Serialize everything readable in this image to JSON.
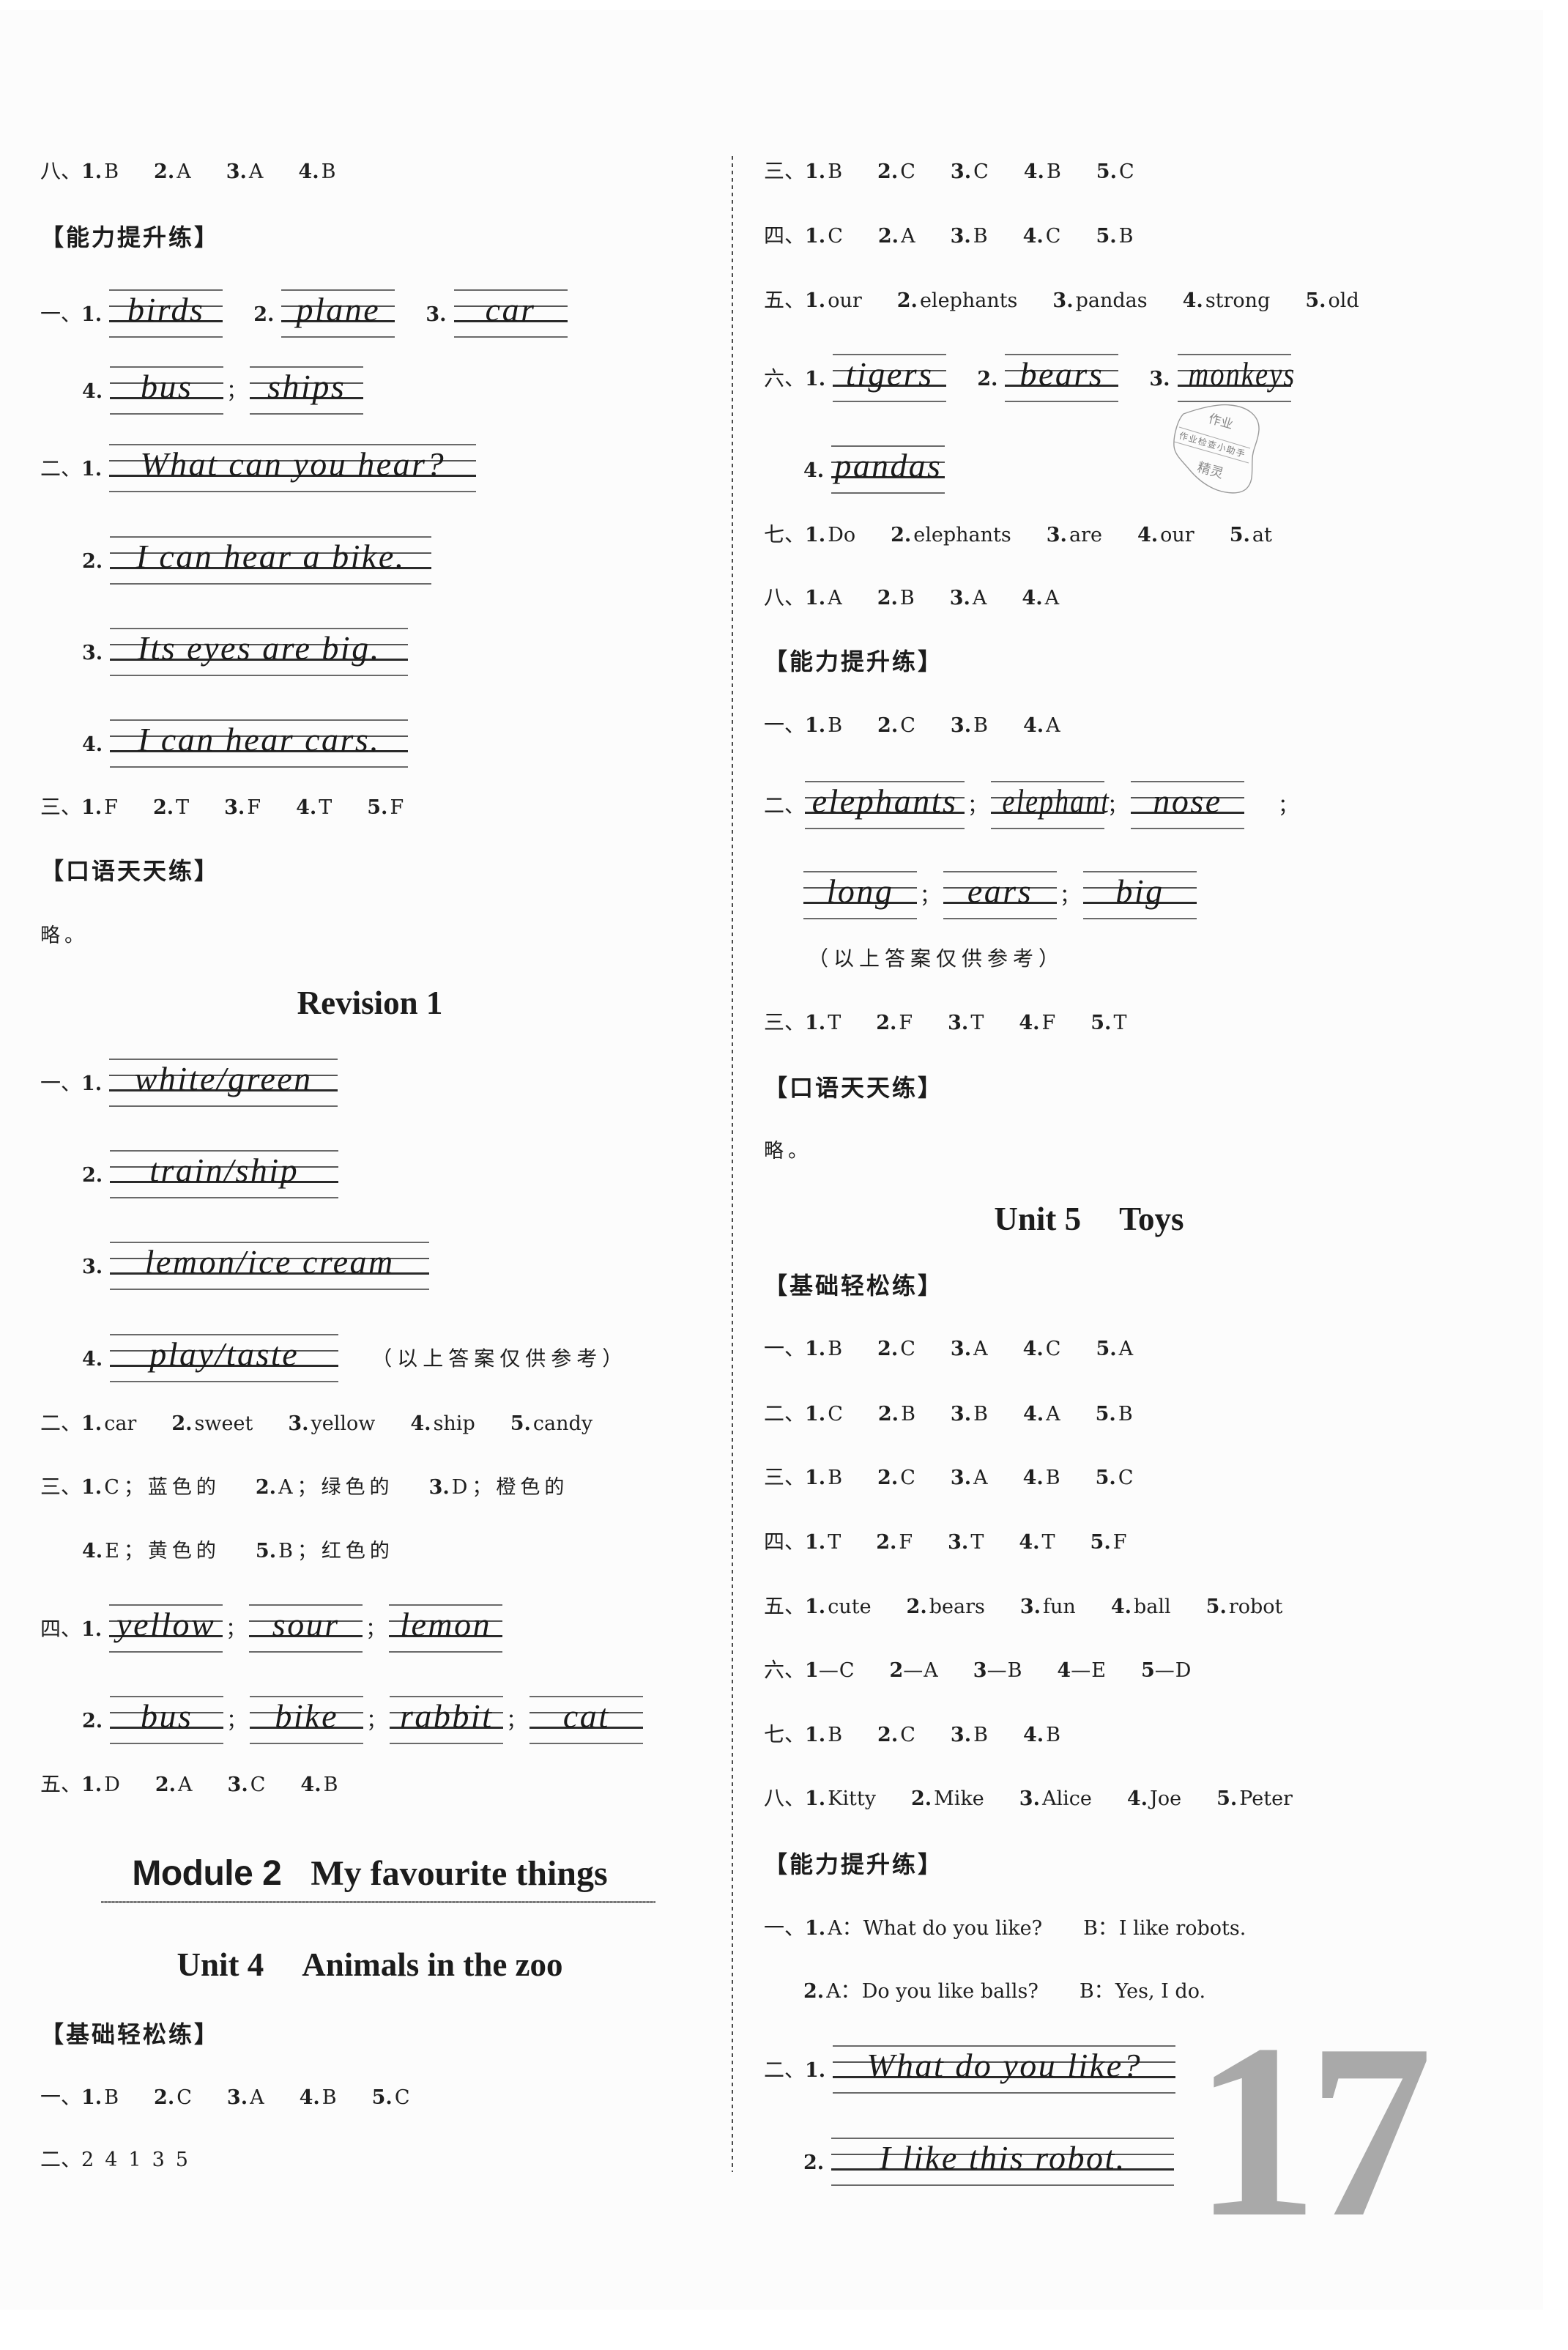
{
  "page_number": "17",
  "blank_separator": "；",
  "stamp": {
    "top": "作业",
    "band": "作业检查小助手",
    "bottom": "精灵"
  },
  "left_column": [
    {
      "kind": "answers",
      "section": "八、",
      "items": [
        {
          "n": "1.",
          "a": "B"
        },
        {
          "n": "2.",
          "a": "A"
        },
        {
          "n": "3.",
          "a": "A"
        },
        {
          "n": "4.",
          "a": "B"
        }
      ]
    },
    {
      "kind": "heading",
      "text": "【能力提升练】"
    },
    {
      "kind": "writing",
      "section": "一、",
      "items": [
        {
          "n": "1.",
          "blanks": [
            "birds"
          ]
        },
        {
          "n": "2.",
          "blanks": [
            "plane"
          ]
        },
        {
          "n": "3.",
          "blanks": [
            "car"
          ]
        }
      ]
    },
    {
      "kind": "writing",
      "items": [
        {
          "n": "4.",
          "blanks": [
            "bus",
            "ships"
          ]
        }
      ]
    },
    {
      "kind": "writing",
      "section": "二、",
      "items": [
        {
          "n": "1.",
          "blanks": [
            "What can you hear?"
          ]
        }
      ]
    },
    {
      "kind": "writing",
      "items": [
        {
          "n": "2.",
          "blanks": [
            "I can hear a bike."
          ]
        }
      ]
    },
    {
      "kind": "writing",
      "items": [
        {
          "n": "3.",
          "blanks": [
            "Its eyes are big."
          ]
        }
      ]
    },
    {
      "kind": "writing",
      "items": [
        {
          "n": "4.",
          "blanks": [
            "I can hear cars."
          ]
        }
      ]
    },
    {
      "kind": "answers",
      "section": "三、",
      "items": [
        {
          "n": "1.",
          "a": "F"
        },
        {
          "n": "2.",
          "a": "T"
        },
        {
          "n": "3.",
          "a": "F"
        },
        {
          "n": "4.",
          "a": "T"
        },
        {
          "n": "5.",
          "a": "F"
        }
      ]
    },
    {
      "kind": "heading",
      "text": "【口语天天练】"
    },
    {
      "kind": "text",
      "text": "略。"
    },
    {
      "kind": "title",
      "text": "Revision 1"
    },
    {
      "kind": "writing",
      "section": "一、",
      "items": [
        {
          "n": "1.",
          "blanks": [
            "white/green"
          ]
        }
      ]
    },
    {
      "kind": "writing",
      "items": [
        {
          "n": "2.",
          "blanks": [
            "train/ship"
          ]
        }
      ]
    },
    {
      "kind": "writing",
      "items": [
        {
          "n": "3.",
          "blanks": [
            "lemon/ice cream"
          ]
        }
      ]
    },
    {
      "kind": "writing",
      "items": [
        {
          "n": "4.",
          "blanks": [
            "play/taste"
          ]
        }
      ],
      "note": "（以上答案仅供参考）"
    },
    {
      "kind": "answers",
      "section": "二、",
      "items": [
        {
          "n": "1.",
          "a": "car"
        },
        {
          "n": "2.",
          "a": "sweet"
        },
        {
          "n": "3.",
          "a": "yellow"
        },
        {
          "n": "4.",
          "a": "ship"
        },
        {
          "n": "5.",
          "a": "candy"
        }
      ]
    },
    {
      "kind": "answers",
      "section": "三、",
      "items": [
        {
          "n": "1.",
          "a": "C；蓝色的"
        },
        {
          "n": "2.",
          "a": "A；绿色的"
        },
        {
          "n": "3.",
          "a": "D；橙色的"
        }
      ]
    },
    {
      "kind": "answers",
      "items": [
        {
          "n": "4.",
          "a": "E；黄色的"
        },
        {
          "n": "5.",
          "a": "B；红色的"
        }
      ]
    },
    {
      "kind": "writing",
      "section": "四、",
      "items": [
        {
          "n": "1.",
          "blanks": [
            "yellow",
            "sour",
            "lemon"
          ]
        }
      ]
    },
    {
      "kind": "writing",
      "items": [
        {
          "n": "2.",
          "blanks": [
            "bus",
            "bike",
            "rabbit",
            "cat"
          ]
        }
      ]
    },
    {
      "kind": "answers",
      "section": "五、",
      "items": [
        {
          "n": "1.",
          "a": "D"
        },
        {
          "n": "2.",
          "a": "A"
        },
        {
          "n": "3.",
          "a": "C"
        },
        {
          "n": "4.",
          "a": "B"
        }
      ]
    },
    {
      "kind": "module_title",
      "label": "Module 2",
      "text": "My favourite things"
    },
    {
      "kind": "title",
      "label": "Unit 4",
      "text": "Animals in the zoo"
    },
    {
      "kind": "heading",
      "text": "【基础轻松练】"
    },
    {
      "kind": "answers",
      "section": "一、",
      "items": [
        {
          "n": "1.",
          "a": "B"
        },
        {
          "n": "2.",
          "a": "C"
        },
        {
          "n": "3.",
          "a": "A"
        },
        {
          "n": "4.",
          "a": "B"
        },
        {
          "n": "5.",
          "a": "C"
        }
      ]
    },
    {
      "kind": "sequence",
      "section": "二、",
      "values": [
        "2",
        "4",
        "1",
        "3",
        "5"
      ]
    }
  ],
  "right_column": [
    {
      "kind": "answers",
      "section": "三、",
      "items": [
        {
          "n": "1.",
          "a": "B"
        },
        {
          "n": "2.",
          "a": "C"
        },
        {
          "n": "3.",
          "a": "C"
        },
        {
          "n": "4.",
          "a": "B"
        },
        {
          "n": "5.",
          "a": "C"
        }
      ]
    },
    {
      "kind": "answers",
      "section": "四、",
      "items": [
        {
          "n": "1.",
          "a": "C"
        },
        {
          "n": "2.",
          "a": "A"
        },
        {
          "n": "3.",
          "a": "B"
        },
        {
          "n": "4.",
          "a": "C"
        },
        {
          "n": "5.",
          "a": "B"
        }
      ]
    },
    {
      "kind": "answers",
      "section": "五、",
      "items": [
        {
          "n": "1.",
          "a": "our"
        },
        {
          "n": "2.",
          "a": "elephants"
        },
        {
          "n": "3.",
          "a": "pandas"
        },
        {
          "n": "4.",
          "a": "strong"
        },
        {
          "n": "5.",
          "a": "old"
        }
      ]
    },
    {
      "kind": "writing",
      "section": "六、",
      "items": [
        {
          "n": "1.",
          "blanks": [
            "tigers"
          ]
        },
        {
          "n": "2.",
          "blanks": [
            "bears"
          ]
        },
        {
          "n": "3.",
          "blanks": [
            "monkeys"
          ]
        }
      ]
    },
    {
      "kind": "writing",
      "items": [
        {
          "n": "4.",
          "blanks": [
            "pandas"
          ]
        }
      ]
    },
    {
      "kind": "answers",
      "section": "七、",
      "items": [
        {
          "n": "1.",
          "a": "Do"
        },
        {
          "n": "2.",
          "a": "elephants"
        },
        {
          "n": "3.",
          "a": "are"
        },
        {
          "n": "4.",
          "a": "our"
        },
        {
          "n": "5.",
          "a": "at"
        }
      ]
    },
    {
      "kind": "answers",
      "section": "八、",
      "items": [
        {
          "n": "1.",
          "a": "A"
        },
        {
          "n": "2.",
          "a": "B"
        },
        {
          "n": "3.",
          "a": "A"
        },
        {
          "n": "4.",
          "a": "A"
        }
      ]
    },
    {
      "kind": "heading",
      "text": "【能力提升练】"
    },
    {
      "kind": "answers",
      "section": "一、",
      "items": [
        {
          "n": "1.",
          "a": "B"
        },
        {
          "n": "2.",
          "a": "C"
        },
        {
          "n": "3.",
          "a": "B"
        },
        {
          "n": "4.",
          "a": "A"
        }
      ]
    },
    {
      "kind": "writing",
      "section": "二、",
      "items": [
        {
          "n": "",
          "blanks": [
            "elephants",
            "elephant",
            "nose"
          ]
        }
      ],
      "trailing": "；"
    },
    {
      "kind": "writing",
      "items": [
        {
          "n": "",
          "blanks": [
            "long",
            "ears",
            "big"
          ]
        }
      ]
    },
    {
      "kind": "note",
      "text": "（以上答案仅供参考）"
    },
    {
      "kind": "answers",
      "section": "三、",
      "items": [
        {
          "n": "1.",
          "a": "T"
        },
        {
          "n": "2.",
          "a": "F"
        },
        {
          "n": "3.",
          "a": "T"
        },
        {
          "n": "4.",
          "a": "F"
        },
        {
          "n": "5.",
          "a": "T"
        }
      ]
    },
    {
      "kind": "heading",
      "text": "【口语天天练】"
    },
    {
      "kind": "text",
      "text": "略。"
    },
    {
      "kind": "title",
      "label": "Unit 5",
      "text": "Toys"
    },
    {
      "kind": "heading",
      "text": "【基础轻松练】"
    },
    {
      "kind": "answers",
      "section": "一、",
      "items": [
        {
          "n": "1.",
          "a": "B"
        },
        {
          "n": "2.",
          "a": "C"
        },
        {
          "n": "3.",
          "a": "A"
        },
        {
          "n": "4.",
          "a": "C"
        },
        {
          "n": "5.",
          "a": "A"
        }
      ]
    },
    {
      "kind": "answers",
      "section": "二、",
      "items": [
        {
          "n": "1.",
          "a": "C"
        },
        {
          "n": "2.",
          "a": "B"
        },
        {
          "n": "3.",
          "a": "B"
        },
        {
          "n": "4.",
          "a": "A"
        },
        {
          "n": "5.",
          "a": "B"
        }
      ]
    },
    {
      "kind": "answers",
      "section": "三、",
      "items": [
        {
          "n": "1.",
          "a": "B"
        },
        {
          "n": "2.",
          "a": "C"
        },
        {
          "n": "3.",
          "a": "A"
        },
        {
          "n": "4.",
          "a": "B"
        },
        {
          "n": "5.",
          "a": "C"
        }
      ]
    },
    {
      "kind": "answers",
      "section": "四、",
      "items": [
        {
          "n": "1.",
          "a": "T"
        },
        {
          "n": "2.",
          "a": "F"
        },
        {
          "n": "3.",
          "a": "T"
        },
        {
          "n": "4.",
          "a": "T"
        },
        {
          "n": "5.",
          "a": "F"
        }
      ]
    },
    {
      "kind": "answers",
      "section": "五、",
      "items": [
        {
          "n": "1.",
          "a": "cute"
        },
        {
          "n": "2.",
          "a": "bears"
        },
        {
          "n": "3.",
          "a": "fun"
        },
        {
          "n": "4.",
          "a": "ball"
        },
        {
          "n": "5.",
          "a": "robot"
        }
      ]
    },
    {
      "kind": "answers",
      "section": "六、",
      "items": [
        {
          "n": "1",
          "joiner": "—",
          "a": "C"
        },
        {
          "n": "2",
          "joiner": "—",
          "a": "A"
        },
        {
          "n": "3",
          "joiner": "—",
          "a": "B"
        },
        {
          "n": "4",
          "joiner": "—",
          "a": "E"
        },
        {
          "n": "5",
          "joiner": "—",
          "a": "D"
        }
      ]
    },
    {
      "kind": "answers",
      "section": "七、",
      "items": [
        {
          "n": "1.",
          "a": "B"
        },
        {
          "n": "2.",
          "a": "C"
        },
        {
          "n": "3.",
          "a": "B"
        },
        {
          "n": "4.",
          "a": "B"
        }
      ]
    },
    {
      "kind": "answers",
      "section": "八、",
      "items": [
        {
          "n": "1.",
          "a": "Kitty"
        },
        {
          "n": "2.",
          "a": "Mike"
        },
        {
          "n": "3.",
          "a": "Alice"
        },
        {
          "n": "4.",
          "a": "Joe"
        },
        {
          "n": "5.",
          "a": "Peter"
        }
      ]
    },
    {
      "kind": "heading",
      "text": "【能力提升练】"
    },
    {
      "kind": "dialog",
      "section": "一、",
      "items": [
        {
          "n": "1.",
          "turns": [
            {
              "speaker": "A：",
              "text": "What do you like?"
            },
            {
              "speaker": "B：",
              "text": "I like robots."
            }
          ]
        }
      ]
    },
    {
      "kind": "dialog",
      "items": [
        {
          "n": "2.",
          "turns": [
            {
              "speaker": "A：",
              "text": "Do you like balls?"
            },
            {
              "speaker": "B：",
              "text": "Yes, I do."
            }
          ]
        }
      ]
    },
    {
      "kind": "writing",
      "section": "二、",
      "items": [
        {
          "n": "1.",
          "blanks": [
            "What do you like?"
          ]
        }
      ]
    },
    {
      "kind": "writing",
      "items": [
        {
          "n": "2.",
          "blanks": [
            "I like this robot."
          ]
        }
      ]
    }
  ]
}
